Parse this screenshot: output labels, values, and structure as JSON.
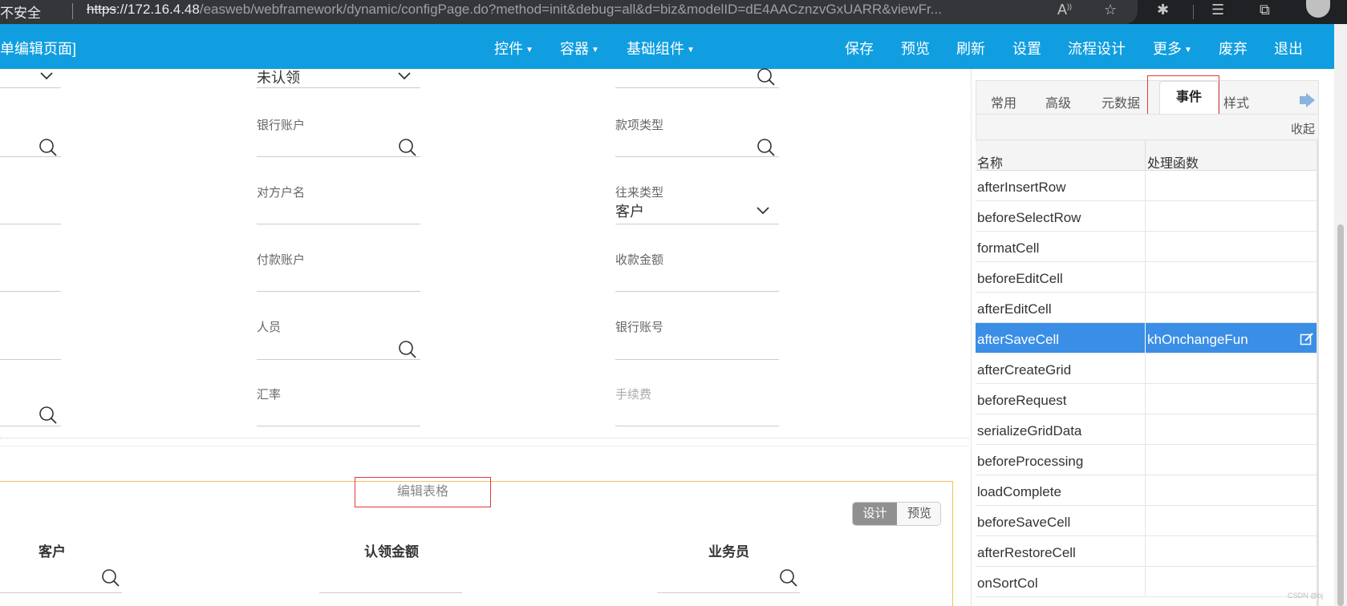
{
  "browser": {
    "security_label": "不安全",
    "url_scheme": "https",
    "url_host": "://172.16.4.48",
    "url_path": "/easweb/webframework/dynamic/configPage.do?method=init&debug=all&d=biz&modelID=dE4AACznzvGxUARR&viewFr..."
  },
  "header": {
    "title": "单编辑页面]",
    "left_menu": [
      {
        "label": "控件"
      },
      {
        "label": "容器"
      },
      {
        "label": "基础组件"
      }
    ],
    "actions": [
      "保存",
      "预览",
      "刷新",
      "设置",
      "流程设计",
      "更多",
      "废弃",
      "退出"
    ]
  },
  "form": {
    "col2": {
      "field1_value": "未认领",
      "bank_account_label": "银行账户",
      "counterparty_name_label": "对方户名",
      "pay_account_label": "付款账户",
      "person_label": "人员",
      "exchange_rate_label": "汇率"
    },
    "col3": {
      "item_type_label": "款项类型",
      "contact_type_label": "往来类型",
      "contact_type_value": "客户",
      "receipt_amount_label": "收款金额",
      "bank_number_label": "银行账号",
      "fee_label": "手续费"
    }
  },
  "grid": {
    "title": "编辑表格",
    "mode_design": "设计",
    "mode_preview": "预览",
    "columns": [
      "客户",
      "认领金额",
      "业务员"
    ]
  },
  "panel": {
    "tabs": [
      "常用",
      "高级",
      "元数据",
      "事件",
      "样式"
    ],
    "active_tab": "事件",
    "collapse_label": "收起",
    "table_headers": {
      "name": "名称",
      "handler": "处理函数"
    },
    "events": [
      {
        "name": "afterInsertRow",
        "handler": ""
      },
      {
        "name": "beforeSelectRow",
        "handler": ""
      },
      {
        "name": "formatCell",
        "handler": ""
      },
      {
        "name": "beforeEditCell",
        "handler": ""
      },
      {
        "name": "afterEditCell",
        "handler": ""
      },
      {
        "name": "afterSaveCell",
        "handler": "khOnchangeFun"
      },
      {
        "name": "afterCreateGrid",
        "handler": ""
      },
      {
        "name": "beforeRequest",
        "handler": ""
      },
      {
        "name": "serializeGridData",
        "handler": ""
      },
      {
        "name": "beforeProcessing",
        "handler": ""
      },
      {
        "name": "loadComplete",
        "handler": ""
      },
      {
        "name": "beforeSaveCell",
        "handler": ""
      },
      {
        "name": "afterRestoreCell",
        "handler": ""
      },
      {
        "name": "onSortCol",
        "handler": ""
      }
    ],
    "selected_event": "afterSaveCell"
  },
  "watermark": "CSDN @bj",
  "colors": {
    "header_bg": "#109ee0",
    "selected_row_bg": "#3a8ee6",
    "highlight_border": "#e03b3b",
    "grid_border": "#f0c060"
  }
}
